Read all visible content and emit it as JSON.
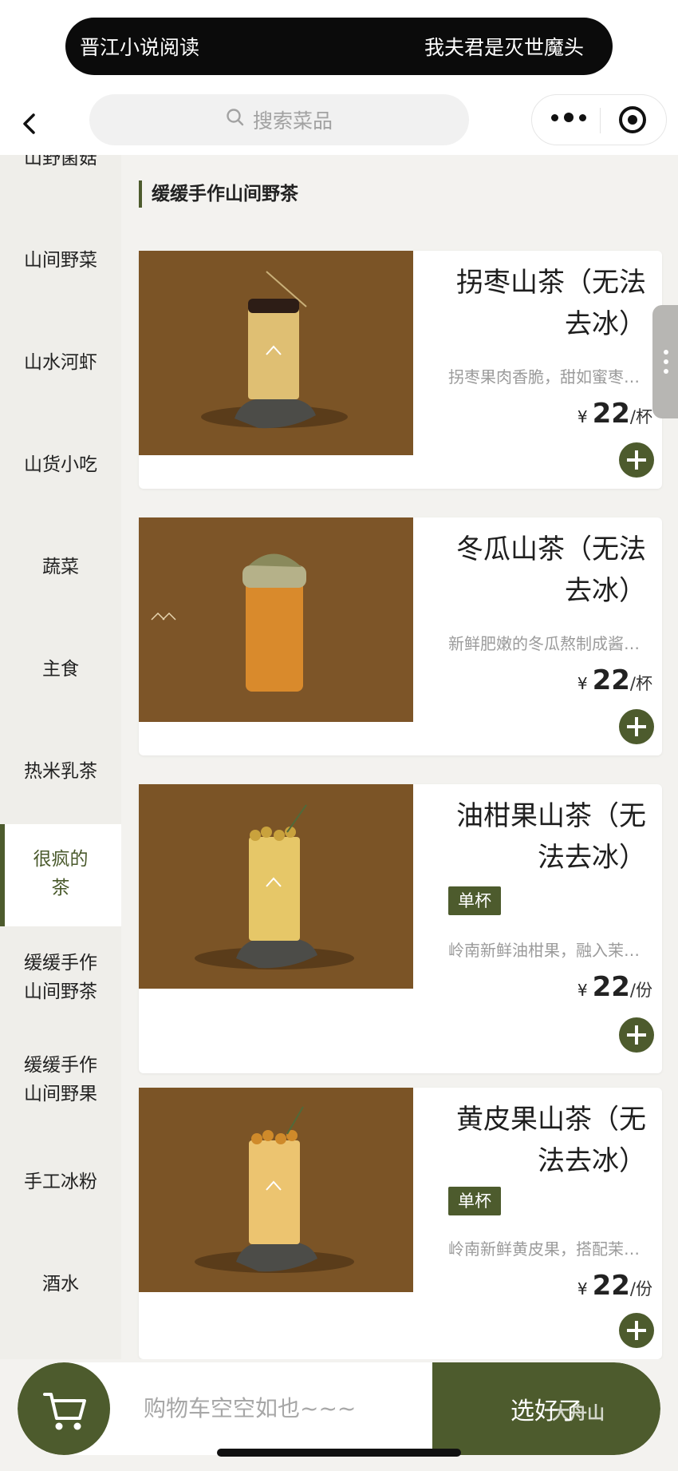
{
  "notice": {
    "left": "晋江小说阅读",
    "right": "我夫君是灭世魔头"
  },
  "search": {
    "placeholder": "搜索菜品"
  },
  "sidebar": {
    "items": [
      {
        "label": "山野菌菇"
      },
      {
        "label": "山间野菜"
      },
      {
        "label": "山水河虾"
      },
      {
        "label": "山货小吃"
      },
      {
        "label": "蔬菜"
      },
      {
        "label": "主食"
      },
      {
        "label": "热米乳茶"
      },
      {
        "label": "很疯的茶",
        "active": true
      },
      {
        "label": "缓缓手作山间野茶"
      },
      {
        "label": "缓缓手作山间野果"
      },
      {
        "label": "手工冰粉"
      },
      {
        "label": "酒水"
      }
    ]
  },
  "section": {
    "title": "缓缓手作山间野茶"
  },
  "products": [
    {
      "name": "拐枣山茶（无法去冰）",
      "tag": "",
      "desc": "拐枣果肉香脆，甜如蜜枣…",
      "currency": "¥",
      "price": "22",
      "unit": "/杯"
    },
    {
      "name": "冬瓜山茶（无法去冰）",
      "tag": "",
      "desc": "新鲜肥嫩的冬瓜熬制成酱…",
      "currency": "¥",
      "price": "22",
      "unit": "/杯"
    },
    {
      "name": "油柑果山茶（无法去冰）",
      "tag": "单杯",
      "desc": "岭南新鲜油柑果，融入茉…",
      "currency": "¥",
      "price": "22",
      "unit": "/份"
    },
    {
      "name": "黄皮果山茶（无法去冰）",
      "tag": "单杯",
      "desc": "岭南新鲜黄皮果，搭配茉…",
      "currency": "¥",
      "price": "22",
      "unit": "/份"
    }
  ],
  "cart": {
    "empty_text": "购物车空空如也~~~",
    "checkout_label": "选好了"
  },
  "watermark": "大舟山",
  "colors": {
    "accent": "#4d5b2d",
    "photo_bg": "#7a5324"
  }
}
